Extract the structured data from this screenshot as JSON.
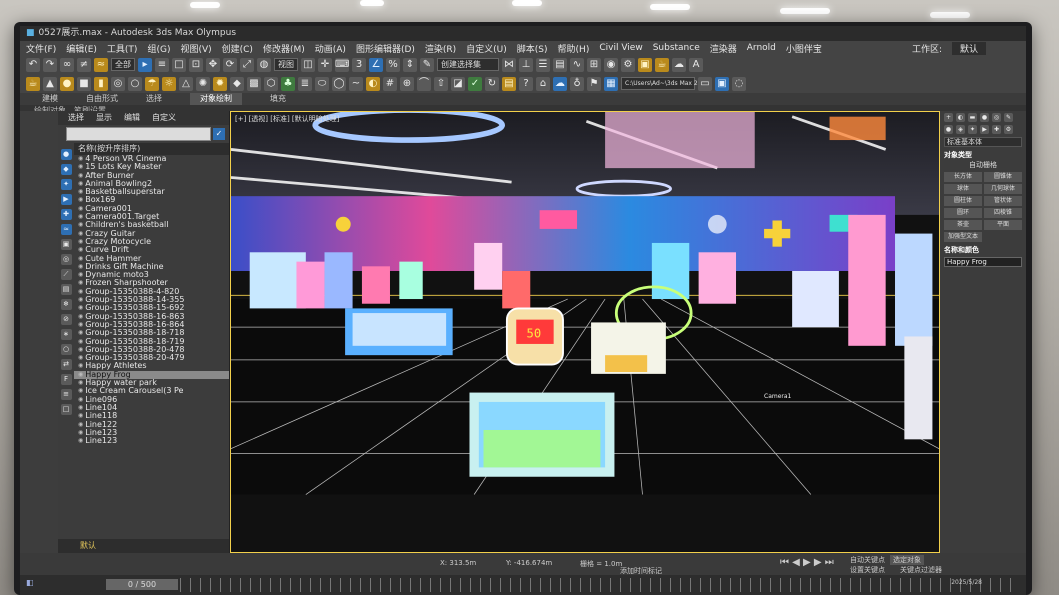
{
  "window": {
    "title": "0527展示.max - Autodesk 3ds Max Olympus"
  },
  "menu": [
    "文件(F)",
    "编辑(E)",
    "工具(T)",
    "组(G)",
    "视图(V)",
    "创建(C)",
    "修改器(M)",
    "动画(A)",
    "图形编辑器(D)",
    "渲染(R)",
    "自定义(U)",
    "脚本(S)",
    "帮助(H)",
    "Civil View",
    "Substance",
    "渲染器",
    "Arnold",
    "小图伴宝"
  ],
  "menu_right": {
    "workspace_label": "工作区:",
    "workspace_value": "默认"
  },
  "toolbar": {
    "filter": "全部",
    "view": "视图",
    "selset": "创建选择集",
    "path": "C:\\Users\\Ad~\\3ds Max 2024"
  },
  "ribbon": {
    "tabs": [
      "建模",
      "自由形式",
      "选择",
      "对象绘制",
      "填充"
    ],
    "active": "对象绘制",
    "sub": [
      "绘制对象",
      "笔刷设置"
    ]
  },
  "explorer": {
    "tabs": [
      "选择",
      "显示",
      "编辑",
      "自定义"
    ],
    "header": "名称(按升序排序)",
    "items": [
      "4 Person VR Cinema",
      "15 Lots Key Master",
      "After Burner",
      "Animal Bowling2",
      "Basketballsuperstar",
      "Box169",
      "Camera001",
      "Camera001.Target",
      "Children's basketball",
      "Crazy Guitar",
      "Crazy Motocycle",
      "Curve Drift",
      "Cute Hammer",
      "Drinks Gift Machine",
      "Dynamic moto3",
      "Frozen Sharpshooter",
      "Group-15350388-4-820",
      "Group-15350388-14-355",
      "Group-15350388-15-692",
      "Group-15350388-16-863",
      "Group-15350388-16-864",
      "Group-15350388-18-718",
      "Group-15350388-18-719",
      "Group-15350388-20-478",
      "Group-15350388-20-479",
      "Happy Athletes",
      "Happy Frog",
      "Happy water park",
      "Ice Cream Carousel(3 Pe",
      "Line096",
      "Line104",
      "Line118",
      "Line122",
      "Line123",
      "Line123"
    ],
    "selected": "Happy Frog",
    "footer": "默认"
  },
  "viewport": {
    "label": "[+] [透视] [标准] [默认明暗处理]",
    "tag": "Camera1",
    "machine_digits": "50"
  },
  "command_panel": {
    "dropdown": "标准基本体",
    "rollout_type": "对象类型",
    "autogrid": "自动栅格",
    "buttons": [
      "长方体",
      "圆锥体",
      "球体",
      "几何球体",
      "圆柱体",
      "管状体",
      "圆环",
      "四棱锥",
      "茶壶",
      "平面",
      "加强型文本"
    ],
    "rollout_name": "名称和颜色",
    "object_name": "Happy Frog"
  },
  "status": {
    "x": "X: 313.5m",
    "y": "Y: -416.674m",
    "grid": "栅格 = 1.0m",
    "autokey": "自动关键点",
    "selected": "选定对象",
    "setkey": "设置关键点",
    "filters": "关键点过滤器",
    "addtime": "添加时间标记"
  },
  "timeline": {
    "frame": "0 / 500"
  },
  "taskbar": {
    "date": "2025/5/28"
  }
}
